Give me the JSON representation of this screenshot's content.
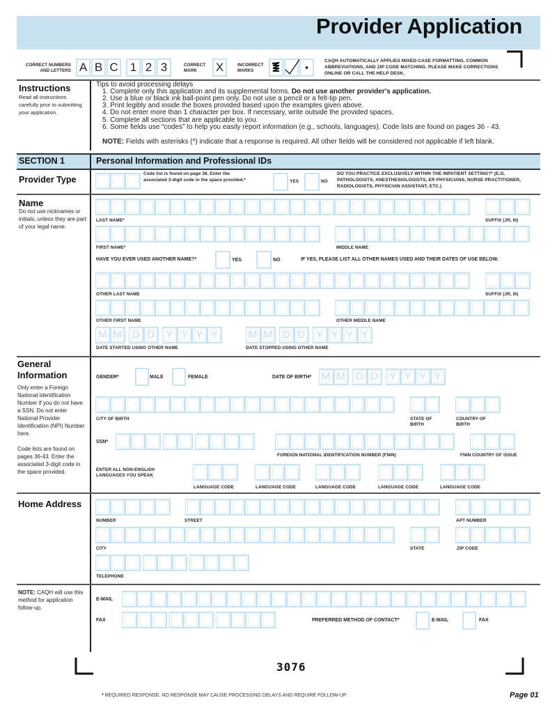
{
  "header": {
    "title": "Provider Application"
  },
  "samples": {
    "correct_label": "CORRECT NUMBERS AND LETTERS",
    "correct_chars": [
      "A",
      "B",
      "C",
      "1",
      "2",
      "3"
    ],
    "correct_mark_label": "CORRECT MARK",
    "correct_mark": "X",
    "incorrect_marks_label": "INCORRECT MARKS",
    "incorrect_marks": [
      "scribble",
      "checkmark",
      "dot"
    ],
    "notice": "CAQH AUTOMATICALLY APPLIES MIXED-CASE FORMATTING, COMMON ABBREVIATIONS, AND ZIP CODE MATCHING. PLEASE MAKE CORRECTIONS ONLINE OR CALL THE HELP DESK."
  },
  "instructions": {
    "heading": "Instructions",
    "side_text": "Read all instructions carefully prior to submitting your application.",
    "tips_heading": "Tips to avoid processing delays",
    "tips": [
      {
        "text": "1. Complete only this application and its supplemental forms. ",
        "bold": "Do not use another provider's application."
      },
      {
        "text": "2. Use a blue or black ink ball-point pen only. Do not use a pencil or a felt-tip pen.",
        "bold": ""
      },
      {
        "text": "3. Print legibly and inside the boxes provided based upon the examples given above.",
        "bold": ""
      },
      {
        "text": "4. Do not enter more than 1 character per box.  If necessary, write outside the provided spaces.",
        "bold": ""
      },
      {
        "text": "5. Complete all sections that are applicable to you.",
        "bold": ""
      },
      {
        "text": "6. Some fields use “codes” to help you easily report information (e.g., schools, languages). Code lists are found on pages 36 - 43.",
        "bold": ""
      }
    ],
    "note_label": "NOTE:",
    "note_text": " Fields with asterisks (*) indicate that a response is required. All other fields will be considered not applicable if left blank."
  },
  "section1": {
    "label": "SECTION 1",
    "title": "Personal Information and Professional IDs"
  },
  "provider_type": {
    "heading": "Provider Type",
    "code_note": "Code list is found on page 36. Enter the associated 3-digit code in the space provided.*",
    "yes": "YES",
    "no": "NO",
    "question": "DO YOU PRACTICE EXCLUSIVELY WITHIN THE INPATIENT SETTING?* (E.G. PATHOLOGISTS, ANESTHESIOLOGISTS, ER PHYSICIANS, NURSE PRACTITIONER, RADIOLOGISTS, PHYSICIAN ASSISTANT, ETC.)"
  },
  "name": {
    "heading": "Name",
    "side_text": "Do not use nicknames or initials, unless they are part of your legal name.",
    "last_name": "LAST NAME*",
    "suffix": "SUFFIX (JR, III)",
    "first_name": "FIRST NAME*",
    "middle_name": "MIDDLE NAME",
    "other_name_q": "HAVE YOU EVER USED ANOTHER NAME?*",
    "yes": "YES",
    "no": "NO",
    "other_name_instr": "IF YES, PLEASE LIST ALL OTHER NAMES USED AND THEIR DATES OF USE BELOW.",
    "other_last": "OTHER LAST NAME",
    "other_suffix": "SUFFIX (JR, III)",
    "other_first": "OTHER FIRST NAME",
    "other_middle": "OTHER MIDDLE NAME",
    "date_started": "DATE STARTED USING OTHER NAME",
    "date_stopped": "DATE STOPPED USING OTHER NAME",
    "date_placeholder": [
      "M",
      "M",
      "D",
      "D",
      "Y",
      "Y",
      "Y",
      "Y"
    ]
  },
  "general": {
    "heading": "General Information",
    "side_text_1": "Only enter a Foreign National Identification Number if you do not have a SSN. Do not enter National Provider Identification (NPI) Number here.",
    "side_text_2": "Code lists are found on pages 36-43. Enter the associated 3-digit code in the space provided.",
    "gender": "GENDER*",
    "male": "MALE",
    "female": "FEMALE",
    "dob": "DATE OF BIRTH*",
    "city_of_birth": "CITY OF BIRTH",
    "state_of_birth": "STATE OF BIRTH",
    "country_of_birth": "COUNTRY OF BIRTH",
    "ssn": "SSN*",
    "fnin": "FOREIGN NATIONAL IDENTIFICATION NUMBER (FNIN)",
    "fnin_country": "FNIN COUNTRY OF ISSUE",
    "languages": "ENTER ALL NON-ENGLISH LANGUAGES YOU SPEAK",
    "language_code": "LANGUAGE CODE"
  },
  "home_address": {
    "heading": "Home Address",
    "number": "NUMBER",
    "street": "STREET",
    "apt": "APT NUMBER",
    "city": "CITY",
    "state": "STATE",
    "zip": "ZIP CODE",
    "telephone": "TELEPHONE"
  },
  "contact": {
    "note_label": "NOTE:",
    "note_text": " CAQH will use this method for application follow-up.",
    "email": "E-MAIL",
    "fax": "FAX",
    "preferred": "PREFERRED METHOD OF CONTACT*",
    "pref_email": "E-MAIL",
    "pref_fax": "FAX"
  },
  "footer": {
    "form_number": "3076",
    "required_note": "REQUIRED RESPONSE. NO RESPONSE MAY CAUSE PROCESSING DELAYS AND REQUIRE FOLLOW-UP.",
    "asterisk": "*",
    "page": "Page 01"
  }
}
